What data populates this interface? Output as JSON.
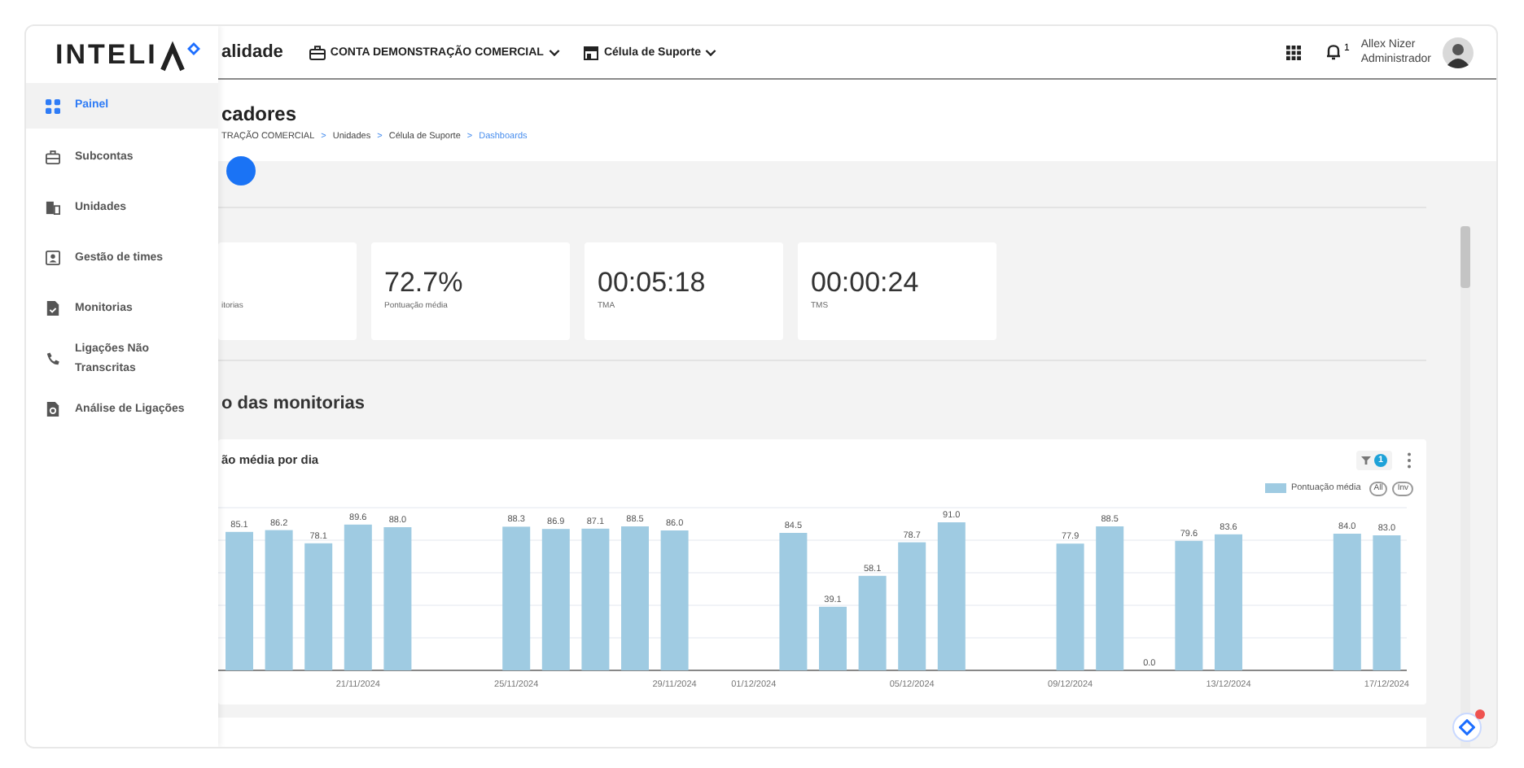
{
  "sidebar": {
    "logo": "INTELI",
    "items": [
      {
        "label": "Painel",
        "kind": "grid",
        "selected": true
      },
      {
        "label": "Subcontas",
        "kind": "briefcase",
        "selected": false
      },
      {
        "label": "Unidades",
        "kind": "building",
        "selected": false
      },
      {
        "label": "Gestão de times",
        "kind": "badge",
        "selected": false
      },
      {
        "label": "Monitorias",
        "kind": "document",
        "selected": false
      },
      {
        "label": "Ligações Não Transcritas",
        "kind": "phone",
        "selected": false
      },
      {
        "label": "Análise de Ligações",
        "kind": "report",
        "selected": false
      }
    ]
  },
  "topbar": {
    "title": "alidade",
    "account": "CONTA DEMONSTRAÇÃO COMERCIAL",
    "unit": "Célula de Suporte",
    "notifications": "1",
    "user_name": "Allex Nizer",
    "user_role": "Administrador"
  },
  "header": {
    "title": "cadores",
    "breadcrumb": [
      {
        "label": "TRAÇÃO COMERCIAL",
        "current": false
      },
      {
        "label": "Unidades",
        "current": false
      },
      {
        "label": "Célula de Suporte",
        "current": false
      },
      {
        "label": "Dashboards",
        "current": true
      }
    ],
    "separator": ">"
  },
  "kpis": [
    {
      "label": "itorias"
    },
    {
      "value": "72.7%",
      "label": "Pontuação média"
    },
    {
      "value": "00:05:18",
      "label": "TMA"
    },
    {
      "value": "00:00:24",
      "label": "TMS"
    }
  ],
  "section_title": "o das monitorias",
  "chart_card": {
    "filter_count": "1",
    "legend_buttons": [
      "All",
      "Inv"
    ],
    "chart_data": {
      "type": "bar",
      "title": "ão média por dia",
      "ylim": [
        0,
        100
      ],
      "data_labels": true,
      "categories": [
        null,
        null,
        null,
        "21/11/2024",
        null,
        null,
        null,
        "25/11/2024",
        null,
        null,
        null,
        "29/11/2024",
        null,
        "01/12/2024",
        null,
        null,
        null,
        "05/12/2024",
        null,
        null,
        null,
        "09/12/2024",
        null,
        null,
        null,
        "13/12/2024",
        null,
        null,
        null,
        "17/12/2024"
      ],
      "series": [
        {
          "name": "Pontuação média",
          "color": "#9fcbe2",
          "values": [
            85.1,
            86.2,
            78.1,
            89.6,
            88.0,
            null,
            null,
            88.3,
            86.9,
            87.1,
            88.5,
            86.0,
            null,
            null,
            84.5,
            39.1,
            58.1,
            78.7,
            91.0,
            null,
            null,
            77.9,
            88.5,
            0.0,
            79.6,
            83.6,
            null,
            null,
            84.0,
            83.0
          ],
          "value_labels": [
            "85.1",
            "86.2",
            "78.1",
            "89.6",
            "88.0",
            null,
            null,
            "88.3",
            "86.9",
            "87.1",
            "88.5",
            "86.0",
            null,
            null,
            "84.5",
            "39.1",
            "58.1",
            "78.7",
            "91.0",
            null,
            null,
            "77.9",
            "88.5",
            "0.0",
            "79.6",
            "83.6",
            null,
            null,
            "84.0",
            "83.0"
          ]
        }
      ]
    }
  }
}
